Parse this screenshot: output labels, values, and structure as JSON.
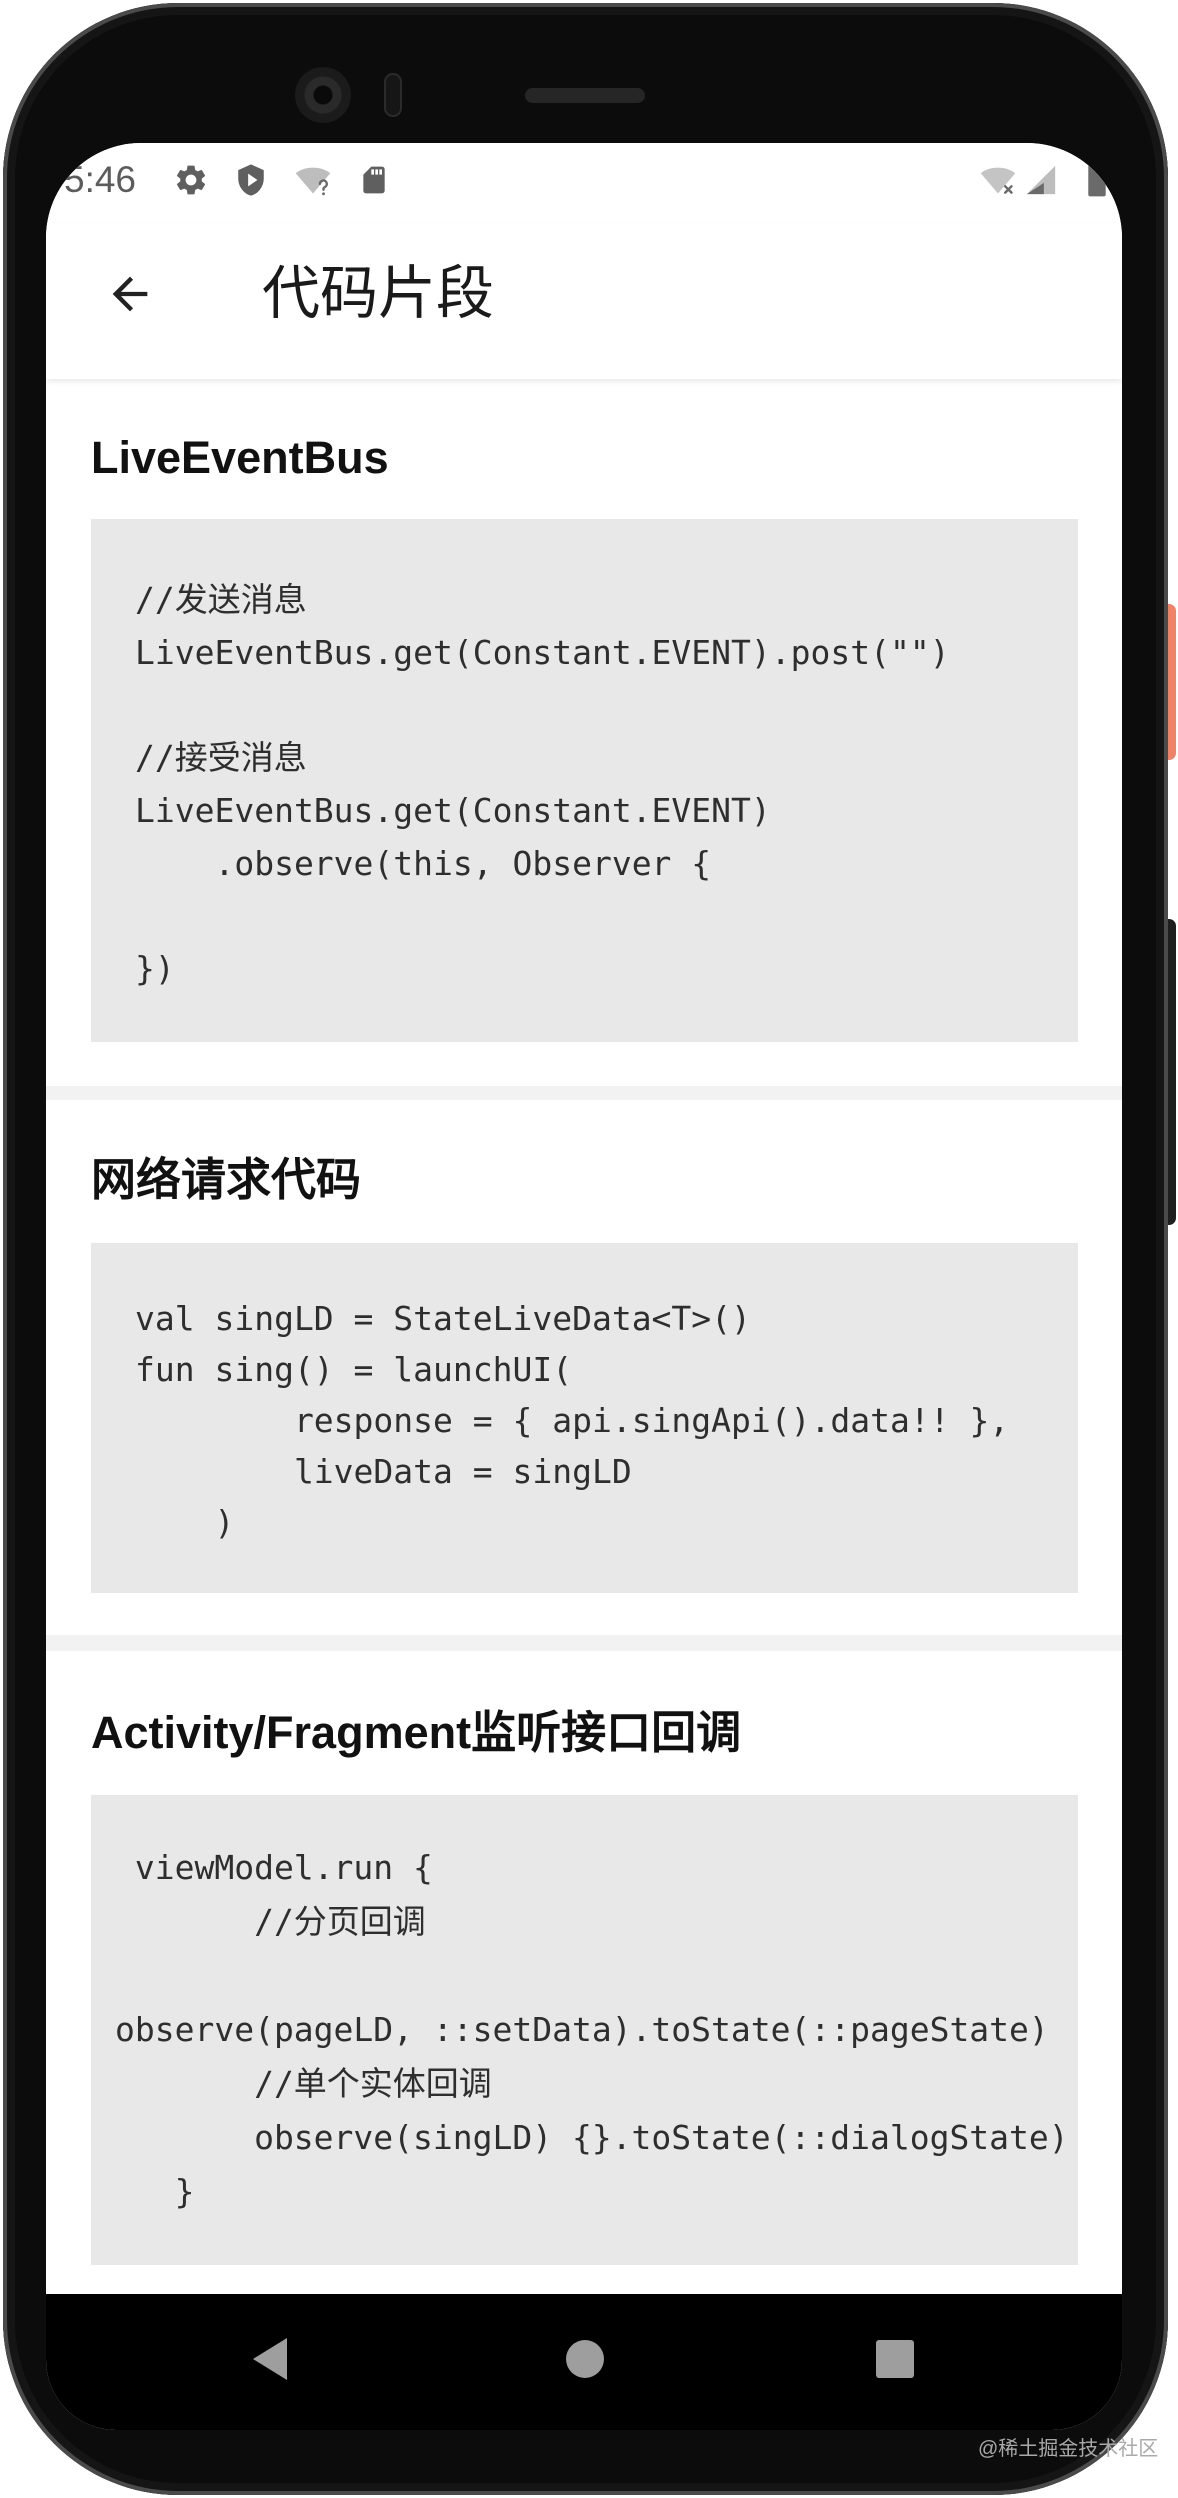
{
  "status_bar": {
    "time": "5:46",
    "icons_left": [
      "gear-icon",
      "shield-icon",
      "wifi-question-icon",
      "sd-card-icon"
    ],
    "icons_right": [
      "wifi-off-icon",
      "signal-icon",
      "battery-icon"
    ]
  },
  "app_bar": {
    "back_icon": "arrow-back-icon",
    "title": "代码片段"
  },
  "snippets": [
    {
      "title": "LiveEventBus",
      "code": "//发送消息\nLiveEventBus.get(Constant.EVENT).post(\"\")\n\n//接受消息\nLiveEventBus.get(Constant.EVENT)\n    .observe(this, Observer {\n\n})"
    },
    {
      "title": "网络请求代码",
      "code": "val singLD = StateLiveData<T>()\nfun sing() = launchUI(\n        response = { api.singApi().data!! },\n        liveData = singLD\n    )"
    },
    {
      "title": "Activity/Fragment监听接口回调",
      "code": " viewModel.run {\n       //分页回调\n\nobserve(pageLD, ::setData).toState(::pageState)\n       //单个实体回调\n       observe(singLD) {}.toState(::dialogState)\n   }"
    }
  ],
  "nav_bar": {
    "icons": [
      "back-triangle-icon",
      "home-circle-icon",
      "recents-square-icon"
    ]
  },
  "watermark": "@稀土掘金技术社区",
  "colors": {
    "code_background": "#e8e8e8",
    "separator": "#f2f2f2",
    "side_button_accent": "#f08265",
    "nav_icon": "#9e9e9e"
  }
}
